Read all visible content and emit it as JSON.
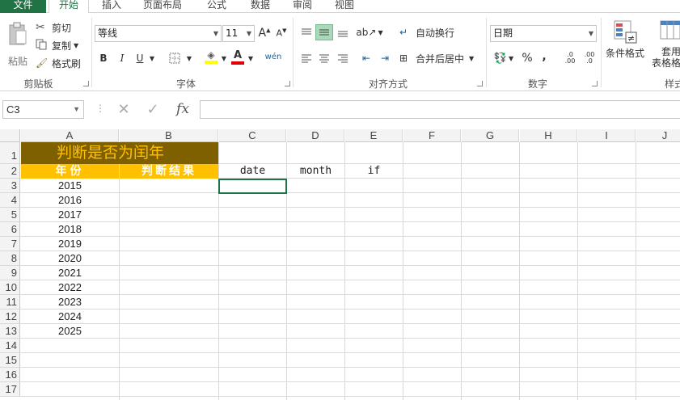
{
  "ribbon": {
    "tabs": [
      "文件",
      "开始",
      "插入",
      "页面布局",
      "公式",
      "数据",
      "审阅",
      "视图"
    ],
    "active_tab": "开始",
    "clipboard": {
      "paste": "粘贴",
      "cut": "剪切",
      "copy": "复制",
      "format_painter": "格式刷",
      "label": "剪贴板"
    },
    "font": {
      "name": "等线",
      "size": "11",
      "bold": "B",
      "italic": "I",
      "underline": "U",
      "phonetic": "wén",
      "label": "字体"
    },
    "alignment": {
      "wrap_text": "自动换行",
      "merge_center": "合并后居中",
      "label": "对齐方式"
    },
    "number": {
      "format": "日期",
      "percent": "%",
      "comma": ",",
      "inc_decimal": ".0 .00",
      "dec_decimal": ".00 .0",
      "label": "数字"
    },
    "styles": {
      "conditional": "条件格式",
      "table_format_1": "套用",
      "table_format_2": "表格格式",
      "label": "样式"
    }
  },
  "formula_bar": {
    "name_box": "C3",
    "formula": ""
  },
  "grid": {
    "columns": [
      "A",
      "B",
      "C",
      "D",
      "E",
      "F",
      "G",
      "H",
      "I",
      "J"
    ],
    "rows": [
      "1",
      "2",
      "3",
      "4",
      "5",
      "6",
      "7",
      "8",
      "9",
      "10",
      "11",
      "12",
      "13",
      "14",
      "15",
      "16",
      "17"
    ],
    "title": "判断是否为闰年",
    "header_year": "年份",
    "header_result": "判断结果",
    "header_c": "date",
    "header_d": "month",
    "header_e": "if",
    "years": [
      "2015",
      "2016",
      "2017",
      "2018",
      "2019",
      "2020",
      "2021",
      "2022",
      "2023",
      "2024",
      "2025"
    ]
  },
  "colors": {
    "title_bg": "#7f6000",
    "title_fg": "#ffc000",
    "header_bg": "#ffc000",
    "accent": "#217346"
  }
}
